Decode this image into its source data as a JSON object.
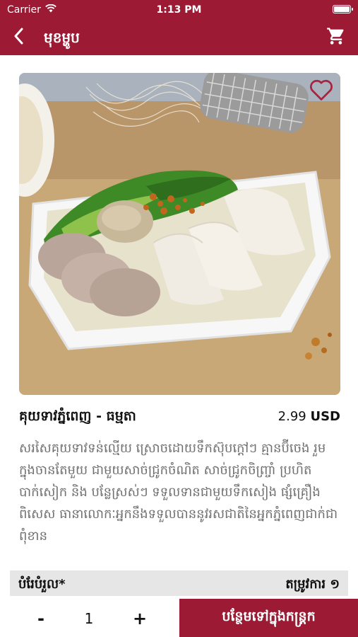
{
  "status_bar": {
    "carrier": "Carrier",
    "time": "1:13 PM"
  },
  "header": {
    "title": "មុខម្ហូប",
    "back_icon": "chevron-left-icon",
    "cart_icon": "shopping-cart-icon"
  },
  "product": {
    "image_icon": "noodle-soup-photo",
    "favorite_icon": "heart-outline-icon",
    "name": "គុយទាវភ្នំពេញ - ធម្មតា",
    "price": "2.99",
    "currency": "USD",
    "description": "សរសៃគុយទាវទន់ល្មើយ ស្រោចដោយទឹកស៊ុបក្តៅៗ គ្មានប៊ីចេង រួមក្នុងចានតែមួយ ជាមួយសាច់ជ្រូកចំណិត សាច់ជ្រូកចិញ្ច្រាំ ប្រហិតបាក់សៀក និង បន្លែស្រស់ៗ ទទួលទានជាមួយទឹកសៀង ផ្សំគ្រឿងពិសេស ធានាលោកៈអ្នកនឹងទទួលបាននូវរសជាតិនៃអ្នកភ្នំពេញជាក់ជាពុំខាន"
  },
  "options": {
    "label": "បំរែបំរួល*",
    "requirement": "តម្រូវការ ១"
  },
  "order": {
    "minus": "-",
    "quantity": "1",
    "plus": "+",
    "add_to_cart": "បន្ថែមទៅក្នុងកន្ត្រក"
  },
  "colors": {
    "brand": "#9c1a34",
    "options_bg": "#e6e6e6",
    "description_text": "#6f6f6f"
  }
}
